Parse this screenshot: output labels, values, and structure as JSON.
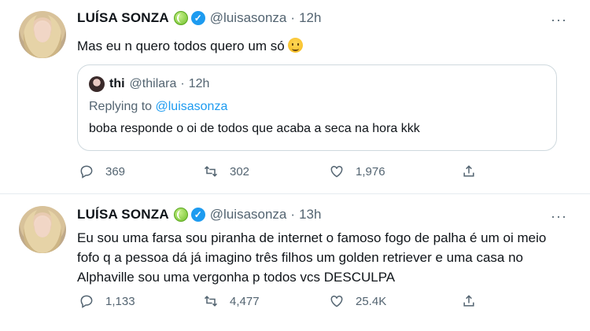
{
  "tweets": [
    {
      "display_name": "LUÍSA SONZA",
      "handle": "@luisasonza",
      "separator": "·",
      "time": "12h",
      "text": "Mas eu n quero todos quero um só",
      "quote": {
        "name": "thi",
        "handle": "@thilara",
        "separator": "·",
        "time": "12h",
        "replying_prefix": "Replying to",
        "replying_to": "@luisasonza",
        "text": "boba responde o oi de todos que acaba a seca na hora kkk"
      },
      "replies": "369",
      "retweets": "302",
      "likes": "1,976"
    },
    {
      "display_name": "LUÍSA SONZA",
      "handle": "@luisasonza",
      "separator": "·",
      "time": "13h",
      "text": "Eu sou uma farsa sou piranha de internet o famoso fogo de palha é um oi meio fofo q a pessoa dá já imagino três filhos um golden retriever e uma casa no Alphaville sou uma vergonha p todos vcs DESCULPA",
      "replies": "1,133",
      "retweets": "4,477",
      "likes": "25.4K"
    }
  ],
  "icons": {
    "reply": "reply-icon",
    "retweet": "retweet-icon",
    "like": "heart-icon",
    "share": "share-icon",
    "more": "more-icon",
    "verified": "verified-badge-icon",
    "tennis_ball": "tennis-ball-icon",
    "emoji": "emoji-icon"
  },
  "colors": {
    "text": "#0f1419",
    "secondary": "#536471",
    "accent": "#1d9bf0",
    "border": "#cfd9de"
  }
}
